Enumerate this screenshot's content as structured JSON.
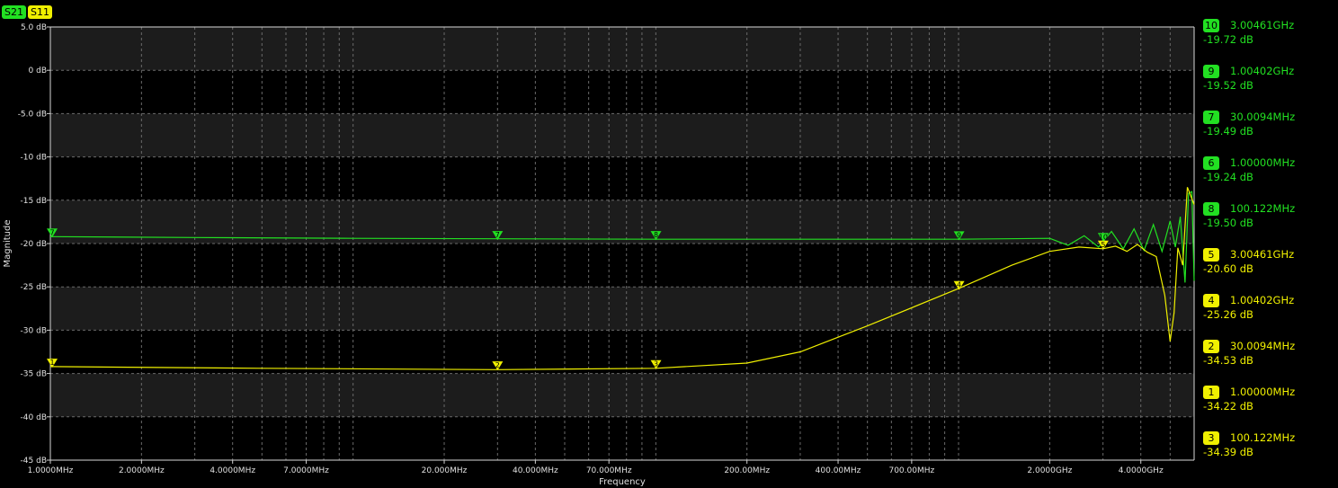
{
  "traces": [
    {
      "name": "S21",
      "color": "#22e022"
    },
    {
      "name": "S11",
      "color": "#f0f000"
    }
  ],
  "chart_data": {
    "type": "line",
    "xlabel": "Frequency",
    "ylabel": "Magnitude",
    "xscale": "log",
    "xlim": [
      1000000,
      6000000000
    ],
    "ylim": [
      -45,
      5
    ],
    "grid": true,
    "yticks": [
      {
        "v": 5,
        "label": "5.0 dB"
      },
      {
        "v": 0,
        "label": "0 dB"
      },
      {
        "v": -5,
        "label": "-5.0 dB"
      },
      {
        "v": -10,
        "label": "-10 dB"
      },
      {
        "v": -15,
        "label": "-15 dB"
      },
      {
        "v": -20,
        "label": "-20 dB"
      },
      {
        "v": -25,
        "label": "-25 dB"
      },
      {
        "v": -30,
        "label": "-30 dB"
      },
      {
        "v": -35,
        "label": "-35 dB"
      },
      {
        "v": -40,
        "label": "-40 dB"
      },
      {
        "v": -45,
        "label": "-45 dB"
      }
    ],
    "xticks": [
      {
        "v": 1000000,
        "label": "1.0000MHz"
      },
      {
        "v": 2000000,
        "label": "2.0000MHz"
      },
      {
        "v": 4000000,
        "label": "4.0000MHz"
      },
      {
        "v": 7000000,
        "label": "7.0000MHz"
      },
      {
        "v": 20000000,
        "label": "20.000MHz"
      },
      {
        "v": 40000000,
        "label": "40.000MHz"
      },
      {
        "v": 70000000,
        "label": "70.000MHz"
      },
      {
        "v": 200000000,
        "label": "200.00MHz"
      },
      {
        "v": 400000000,
        "label": "400.00MHz"
      },
      {
        "v": 700000000,
        "label": "700.00MHz"
      },
      {
        "v": 2000000000,
        "label": "2.0000GHz"
      },
      {
        "v": 4000000000,
        "label": "4.0000GHz"
      }
    ],
    "series": [
      {
        "name": "S21",
        "color": "#22e022",
        "points": [
          [
            1000000,
            -19.2
          ],
          [
            3000000,
            -19.3
          ],
          [
            10000000,
            -19.4
          ],
          [
            30000000,
            -19.45
          ],
          [
            100000000,
            -19.5
          ],
          [
            300000000,
            -19.5
          ],
          [
            1000000000,
            -19.5
          ],
          [
            2000000000,
            -19.4
          ],
          [
            2300000000,
            -20.2
          ],
          [
            2600000000,
            -19.1
          ],
          [
            2900000000,
            -20.4
          ],
          [
            3200000000,
            -18.6
          ],
          [
            3500000000,
            -20.6
          ],
          [
            3800000000,
            -18.3
          ],
          [
            4100000000,
            -20.8
          ],
          [
            4400000000,
            -17.8
          ],
          [
            4700000000,
            -20.9
          ],
          [
            5000000000,
            -17.4
          ],
          [
            5200000000,
            -20.4
          ],
          [
            5400000000,
            -16.9
          ],
          [
            5600000000,
            -24.5
          ],
          [
            5750000000,
            -14.2
          ],
          [
            5900000000,
            -14.0
          ],
          [
            6000000000,
            -24.3
          ]
        ]
      },
      {
        "name": "S11",
        "color": "#f0f000",
        "points": [
          [
            1000000,
            -34.2
          ],
          [
            5000000,
            -34.4
          ],
          [
            30000000,
            -34.55
          ],
          [
            100000000,
            -34.4
          ],
          [
            200000000,
            -33.8
          ],
          [
            300000000,
            -32.5
          ],
          [
            500000000,
            -29.5
          ],
          [
            1000000000,
            -25.2
          ],
          [
            1500000000,
            -22.5
          ],
          [
            2000000000,
            -20.9
          ],
          [
            2500000000,
            -20.4
          ],
          [
            3000000000,
            -20.6
          ],
          [
            3300000000,
            -20.3
          ],
          [
            3600000000,
            -20.9
          ],
          [
            3900000000,
            -20.1
          ],
          [
            4200000000,
            -21.0
          ],
          [
            4500000000,
            -21.5
          ],
          [
            4800000000,
            -26.0
          ],
          [
            5000000000,
            -31.3
          ],
          [
            5150000000,
            -28.0
          ],
          [
            5300000000,
            -20.5
          ],
          [
            5500000000,
            -22.5
          ],
          [
            5700000000,
            -13.5
          ],
          [
            6000000000,
            -15.5
          ]
        ]
      }
    ],
    "plot_markers": [
      {
        "id": "7",
        "series": "S21",
        "x": 1000000,
        "y": -19.2
      },
      {
        "id": "7",
        "series": "S21",
        "x": 30009400,
        "y": -19.49
      },
      {
        "id": "8",
        "series": "S21",
        "x": 100122000,
        "y": -19.5
      },
      {
        "id": "9",
        "series": "S21",
        "x": 1004020000,
        "y": -19.52
      },
      {
        "id": "10",
        "series": "S21",
        "x": 3004610000,
        "y": -19.72
      },
      {
        "id": "1",
        "series": "S11",
        "x": 1000000,
        "y": -34.22
      },
      {
        "id": "2",
        "series": "S11",
        "x": 30009400,
        "y": -34.53
      },
      {
        "id": "3",
        "series": "S11",
        "x": 100122000,
        "y": -34.39
      },
      {
        "id": "4",
        "series": "S11",
        "x": 1004020000,
        "y": -25.26
      },
      {
        "id": "5",
        "series": "S11",
        "x": 3004610000,
        "y": -20.6
      }
    ]
  },
  "marker_panel": [
    {
      "id": "10",
      "freq": "3.00461GHz",
      "value": "-19.72 dB",
      "color": "#22e022"
    },
    {
      "id": "9",
      "freq": "1.00402GHz",
      "value": "-19.52 dB",
      "color": "#22e022"
    },
    {
      "id": "7",
      "freq": "30.0094MHz",
      "value": "-19.49 dB",
      "color": "#22e022"
    },
    {
      "id": "6",
      "freq": "1.00000MHz",
      "value": "-19.24 dB",
      "color": "#22e022"
    },
    {
      "id": "8",
      "freq": "100.122MHz",
      "value": "-19.50 dB",
      "color": "#22e022"
    },
    {
      "id": "5",
      "freq": "3.00461GHz",
      "value": "-20.60 dB",
      "color": "#f0f000"
    },
    {
      "id": "4",
      "freq": "1.00402GHz",
      "value": "-25.26 dB",
      "color": "#f0f000"
    },
    {
      "id": "2",
      "freq": "30.0094MHz",
      "value": "-34.53 dB",
      "color": "#f0f000"
    },
    {
      "id": "1",
      "freq": "1.00000MHz",
      "value": "-34.22 dB",
      "color": "#f0f000"
    },
    {
      "id": "3",
      "freq": "100.122MHz",
      "value": "-34.39 dB",
      "color": "#f0f000"
    }
  ]
}
